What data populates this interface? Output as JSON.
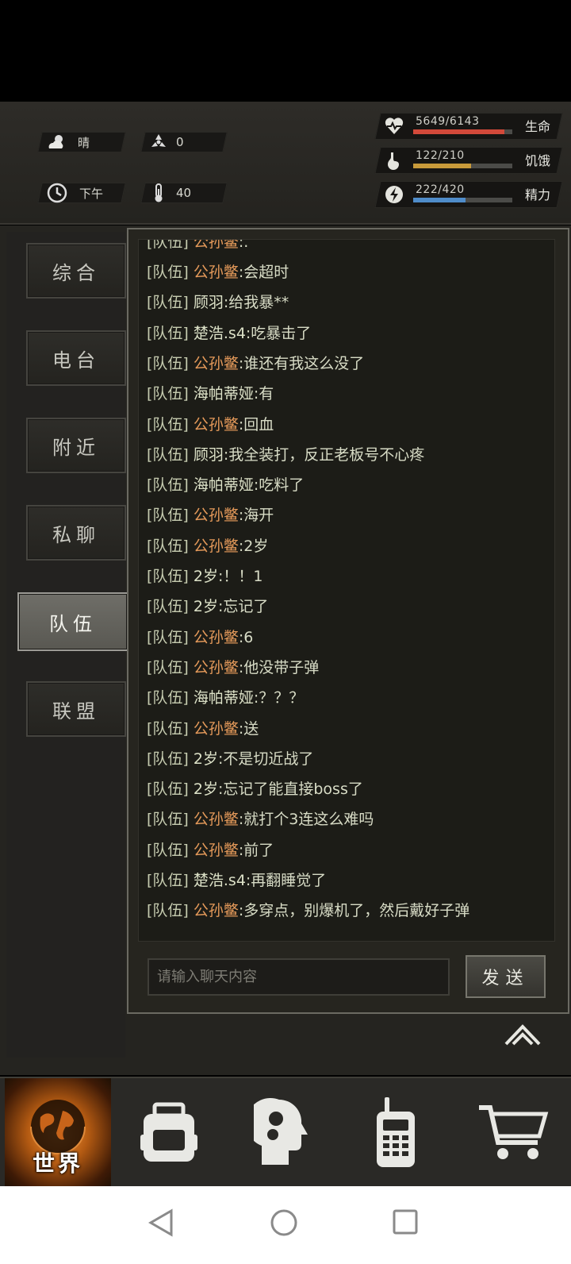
{
  "header": {
    "weather": {
      "icon": "cloud-sun-icon",
      "value": "晴"
    },
    "radiation": {
      "icon": "radiation-icon",
      "value": "0"
    },
    "time": {
      "icon": "clock-icon",
      "value": "下午"
    },
    "temperature": {
      "icon": "thermometer-icon",
      "value": "40"
    },
    "vitals": [
      {
        "name": "health",
        "icon": "heart-pulse-icon",
        "text": "5649/6143",
        "label": "生命",
        "fraction": 0.92,
        "color": "#d2493a"
      },
      {
        "name": "hunger",
        "icon": "stomach-icon",
        "text": "122/210",
        "label": "饥饿",
        "fraction": 0.58,
        "color": "#c89a3a"
      },
      {
        "name": "energy",
        "icon": "energy-icon",
        "text": "222/420",
        "label": "精力",
        "fraction": 0.53,
        "color": "#4f8cc9"
      }
    ]
  },
  "tabs": [
    {
      "key": "general",
      "label": "综合",
      "active": false
    },
    {
      "key": "radio",
      "label": "电台",
      "active": false
    },
    {
      "key": "nearby",
      "label": "附近",
      "active": false
    },
    {
      "key": "private",
      "label": "私聊",
      "active": false
    },
    {
      "key": "team",
      "label": "队伍",
      "active": true
    },
    {
      "key": "alliance",
      "label": "联盟",
      "active": false
    }
  ],
  "chat": {
    "partial_top": {
      "tag": "[队伍]",
      "name": "公孙鳖",
      "text": ":."
    },
    "messages": [
      {
        "tag": "[队伍]",
        "name": "公孙鳖",
        "self": true,
        "text": ":会超时"
      },
      {
        "tag": "[队伍]",
        "name": "顾羽",
        "self": false,
        "text": ":给我暴**"
      },
      {
        "tag": "[队伍]",
        "name": "楚浩.s4",
        "self": false,
        "text": ":吃暴击了"
      },
      {
        "tag": "[队伍]",
        "name": "公孙鳖",
        "self": true,
        "text": ":谁还有我这么没了"
      },
      {
        "tag": "[队伍]",
        "name": "海帕蒂娅",
        "self": false,
        "text": ":有"
      },
      {
        "tag": "[队伍]",
        "name": "公孙鳖",
        "self": true,
        "text": ":回血"
      },
      {
        "tag": "[队伍]",
        "name": "顾羽",
        "self": false,
        "text": ":我全装打，反正老板号不心疼"
      },
      {
        "tag": "[队伍]",
        "name": "海帕蒂娅",
        "self": false,
        "text": ":吃料了"
      },
      {
        "tag": "[队伍]",
        "name": "公孙鳖",
        "self": true,
        "text": ":海开"
      },
      {
        "tag": "[队伍]",
        "name": "公孙鳖",
        "self": true,
        "text": ":2岁"
      },
      {
        "tag": "[队伍]",
        "name": "2岁",
        "self": false,
        "text": ":！！1"
      },
      {
        "tag": "[队伍]",
        "name": "2岁",
        "self": false,
        "text": ":忘记了"
      },
      {
        "tag": "[队伍]",
        "name": "公孙鳖",
        "self": true,
        "text": ":6"
      },
      {
        "tag": "[队伍]",
        "name": "公孙鳖",
        "self": true,
        "text": ":他没带子弹"
      },
      {
        "tag": "[队伍]",
        "name": "海帕蒂娅",
        "self": false,
        "text": ":？？？"
      },
      {
        "tag": "[队伍]",
        "name": "公孙鳖",
        "self": true,
        "text": ":送"
      },
      {
        "tag": "[队伍]",
        "name": "2岁",
        "self": false,
        "text": ":不是切近战了"
      },
      {
        "tag": "[队伍]",
        "name": "2岁",
        "self": false,
        "text": ":忘记了能直接boss了"
      },
      {
        "tag": "[队伍]",
        "name": "公孙鳖",
        "self": true,
        "text": ":就打个3连这么难吗"
      },
      {
        "tag": "[队伍]",
        "name": "公孙鳖",
        "self": true,
        "text": ":前了"
      },
      {
        "tag": "[队伍]",
        "name": "楚浩.s4",
        "self": false,
        "text": ":再翻睡觉了"
      },
      {
        "tag": "[队伍]",
        "name": "公孙鳖",
        "self": true,
        "text": ":多穿点，别爆机了，然后戴好子弹"
      }
    ],
    "input_placeholder": "请输入聊天内容",
    "send_label": "发送"
  },
  "bottom_nav": [
    {
      "key": "world",
      "label": "世界",
      "icon": "globe-icon",
      "active": true
    },
    {
      "key": "backpack",
      "icon": "backpack-icon",
      "active": false
    },
    {
      "key": "skills",
      "icon": "head-gears-icon",
      "active": false
    },
    {
      "key": "radio",
      "icon": "walkie-talkie-icon",
      "active": false
    },
    {
      "key": "shop",
      "icon": "shopping-cart-icon",
      "active": false
    }
  ]
}
